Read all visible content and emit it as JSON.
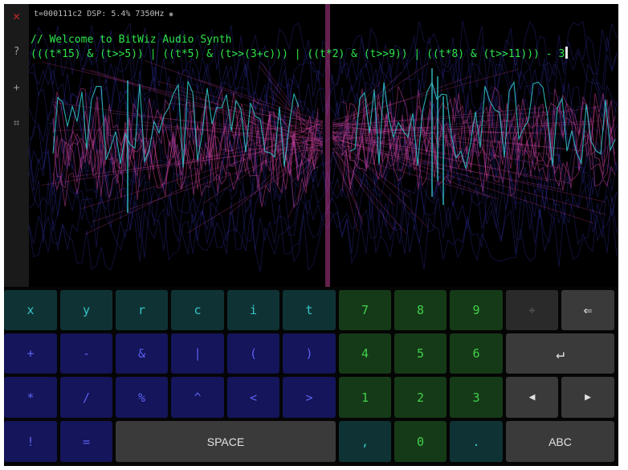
{
  "sidebar": {
    "close_glyph": "✕",
    "help_label": "?",
    "add_label": "+",
    "grid_label": "⌗"
  },
  "status": {
    "text": "t=000111c2 DSP: 5.4% 7350Hz",
    "indicator": "●"
  },
  "editor": {
    "comment": "// Welcome to BitWiz Audio Synth",
    "expression": "(((t*15) & (t>>5)) | ((t*5) & (t>>(3+c))) | ((t*2) & (t>>9)) | ((t*8) & (t>>11))) - 3"
  },
  "keys": {
    "x": "x",
    "y": "y",
    "r": "r",
    "c": "c",
    "i": "i",
    "t": "t",
    "plus": "+",
    "minus": "-",
    "amp": "&",
    "pipe": "|",
    "lparen": "(",
    "rparen": ")",
    "star": "*",
    "slash": "/",
    "percent": "%",
    "caret": "^",
    "lt": "<",
    "gt": ">",
    "bang": "!",
    "equals": "=",
    "space": "SPACE",
    "d7": "7",
    "d8": "8",
    "d9": "9",
    "d4": "4",
    "d5": "5",
    "d6": "6",
    "d1": "1",
    "d2": "2",
    "d3": "3",
    "comma": ",",
    "d0": "0",
    "dot": ".",
    "crosshair": "⌖",
    "backspace": "⇐",
    "enter": "↵",
    "left": "◀",
    "right": "▶",
    "abc": "ABC"
  },
  "colors": {
    "code_text": "#2ee64a",
    "close": "#c0262b",
    "var_keys": "#36c4c8",
    "op_keys": "#5d60f0",
    "digit_keys": "#41d04c",
    "wave_pink": "#c8409a",
    "wave_cyan": "#30c0c8",
    "wave_blue": "#3a3ac8"
  }
}
